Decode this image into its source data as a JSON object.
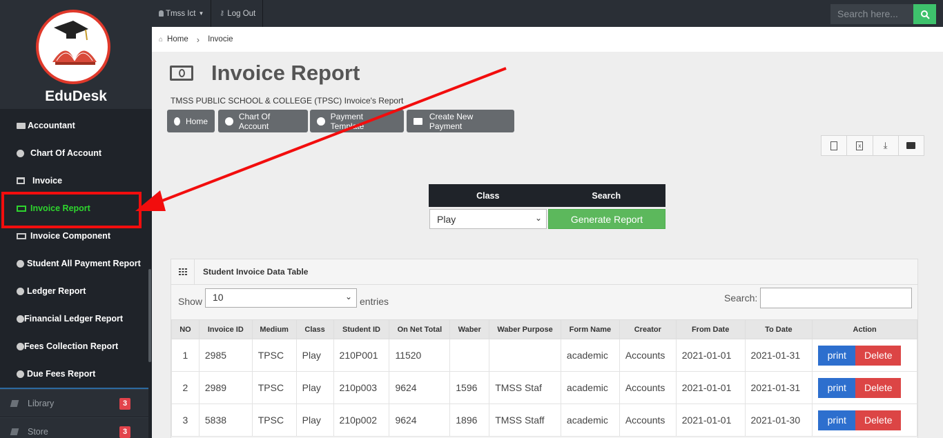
{
  "brand": {
    "name": "EduDesk"
  },
  "topbar": {
    "user": "Tmss Ict",
    "logout": "Log Out",
    "search_placeholder": "Search here..."
  },
  "breadcrumb": {
    "home": "Home",
    "current": "Invocie"
  },
  "sidebar": {
    "items": [
      {
        "label": "Accountant",
        "icon": "briefcase-icon"
      },
      {
        "label": "Chart Of Account",
        "icon": "pie-chart-icon"
      },
      {
        "label": "Invoice",
        "icon": "window-icon"
      },
      {
        "label": "Invoice Report",
        "icon": "money-icon",
        "active": true
      },
      {
        "label": "Invoice Component",
        "icon": "money-icon"
      },
      {
        "label": "Student All Payment Report",
        "icon": "circle-icon"
      },
      {
        "label": "Ledger Report",
        "icon": "circle-icon"
      },
      {
        "label": "Financial Ledger Report",
        "icon": "circle-icon"
      },
      {
        "label": "Fees Collection Report",
        "icon": "circle-icon"
      },
      {
        "label": "Due Fees Report",
        "icon": "circle-icon"
      }
    ],
    "sections": [
      {
        "label": "Library",
        "badge": "3",
        "icon": "book-icon"
      },
      {
        "label": "Store",
        "badge": "3",
        "icon": "book-icon"
      }
    ]
  },
  "header": {
    "title": "Invoice Report",
    "subtitle": "TMSS PUBLIC SCHOOL & COLLEGE (TPSC) Invoice's Report",
    "nav_buttons": [
      "Home",
      "Chart Of Account",
      "Payment Template",
      "Create New Payment"
    ]
  },
  "filter": {
    "class_header": "Class",
    "search_header": "Search",
    "class_value": "Play",
    "generate": "Generate Report"
  },
  "panel": {
    "title": "Student Invoice Data Table",
    "show": "Show",
    "entries_value": "10",
    "entries": "entries",
    "search": "Search:"
  },
  "table": {
    "columns": [
      "NO",
      "Invoice ID",
      "Medium",
      "Class",
      "Student ID",
      "On Net Total",
      "Waber",
      "Waber Purpose",
      "Form Name",
      "Creator",
      "From Date",
      "To Date",
      "Action"
    ],
    "rows": [
      [
        "1",
        "2985",
        "TPSC",
        "Play",
        "210P001",
        "11520",
        "",
        "",
        "academic",
        "Accounts",
        "2021-01-01",
        "2021-01-31"
      ],
      [
        "2",
        "2989",
        "TPSC",
        "Play",
        "210p003",
        "9624",
        "1596",
        "TMSS Staf",
        "academic",
        "Accounts",
        "2021-01-01",
        "2021-01-31"
      ],
      [
        "3",
        "5838",
        "TPSC",
        "Play",
        "210p002",
        "9624",
        "1896",
        "TMSS Staff",
        "academic",
        "Accounts",
        "2021-01-01",
        "2021-01-30"
      ]
    ],
    "print_label": "print",
    "delete_label": "Delete"
  },
  "colors": {
    "annotation": "#f20d0d",
    "active_menu": "#2ed52e",
    "primary": "#2d6fce",
    "danger": "#dc4545",
    "success": "#5cb85c"
  }
}
